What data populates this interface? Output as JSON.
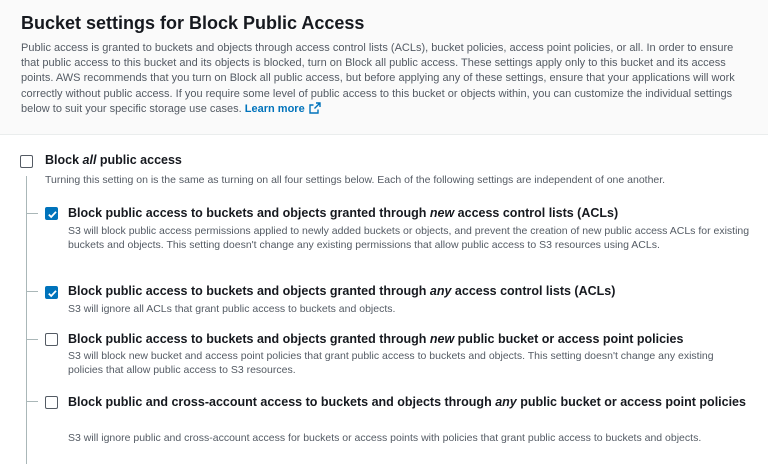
{
  "header": {
    "title": "Bucket settings for Block Public Access",
    "description": "Public access is granted to buckets and objects through access control lists (ACLs), bucket policies, access point policies, or all. In order to ensure that public access to this bucket and its objects is blocked, turn on Block all public access. These settings apply only to this bucket and its access points. AWS recommends that you turn on Block all public access, but before applying any of these settings, ensure that your applications will work correctly without public access. If you require some level of public access to this bucket or objects within, you can customize the individual settings below to suit your specific storage use cases.",
    "learn_more": "Learn more"
  },
  "block_all": {
    "label_prefix": "Block ",
    "label_emphasis": "all",
    "label_suffix": " public access",
    "checked": false,
    "description": "Turning this setting on is the same as turning on all four settings below. Each of the following settings are independent of one another."
  },
  "options": [
    {
      "title_prefix": "Block public access to buckets and objects granted through ",
      "title_emphasis": "new",
      "title_suffix": " access control lists (ACLs)",
      "checked": true,
      "description": "S3 will block public access permissions applied to newly added buckets or objects, and prevent the creation of new public access ACLs for existing buckets and objects. This setting doesn't change any existing permissions that allow public access to S3 resources using ACLs."
    },
    {
      "title_prefix": "Block public access to buckets and objects granted through ",
      "title_emphasis": "any",
      "title_suffix": " access control lists (ACLs)",
      "checked": true,
      "description": "S3 will ignore all ACLs that grant public access to buckets and objects."
    },
    {
      "title_prefix": "Block public access to buckets and objects granted through ",
      "title_emphasis": "new",
      "title_suffix": " public bucket or access point policies",
      "checked": false,
      "description": "S3 will block new bucket and access point policies that grant public access to buckets and objects. This setting doesn't change any existing policies that allow public access to S3 resources."
    },
    {
      "title_prefix": "Block public and cross-account access to buckets and objects through ",
      "title_emphasis": "any",
      "title_suffix": " public bucket or access point policies",
      "checked": false,
      "description": "S3 will ignore public and cross-account access for buckets or access points with policies that grant public access to buckets and objects."
    }
  ],
  "colors": {
    "accent": "#0073bb",
    "text": "#16191f",
    "muted": "#545b64"
  }
}
